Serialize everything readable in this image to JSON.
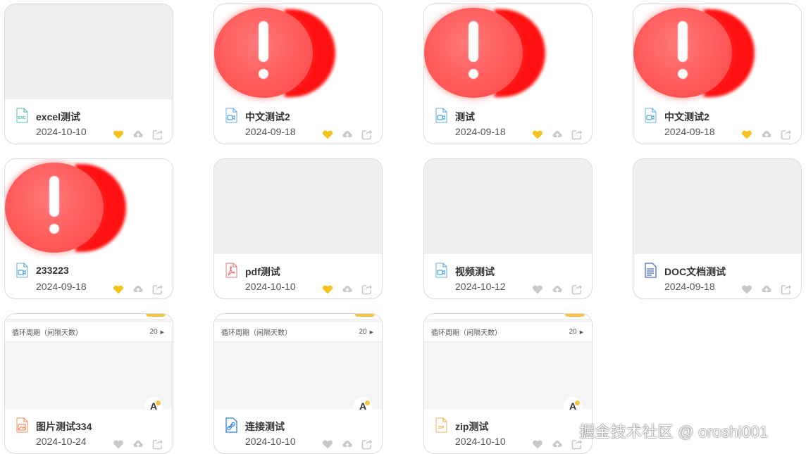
{
  "colors": {
    "favorite_active": "#f7c21b",
    "action_inactive": "#c8c8c8",
    "error_red": "#ff1111",
    "card_border": "#d9d9d9",
    "thumb_placeholder": "#efefef"
  },
  "cards": [
    {
      "name": "excel测试",
      "date": "2024-10-10",
      "file_icon": "excel-file-icon",
      "thumbnail": "placeholder",
      "favorited": true
    },
    {
      "name": "中文测试2",
      "date": "2024-09-18",
      "file_icon": "video-file-icon",
      "thumbnail": "error",
      "favorited": true
    },
    {
      "name": "测试",
      "date": "2024-09-18",
      "file_icon": "video-file-icon",
      "thumbnail": "error",
      "favorited": true
    },
    {
      "name": "中文测试2",
      "date": "2024-09-18",
      "file_icon": "video-file-icon",
      "thumbnail": "error",
      "favorited": true
    },
    {
      "name": "233223",
      "date": "2024-09-18",
      "file_icon": "video-file-icon",
      "thumbnail": "error",
      "favorited": true
    },
    {
      "name": "pdf测试",
      "date": "2024-10-10",
      "file_icon": "pdf-file-icon",
      "thumbnail": "placeholder",
      "favorited": true
    },
    {
      "name": "视频测试",
      "date": "2024-10-12",
      "file_icon": "video-file-icon",
      "thumbnail": "placeholder",
      "favorited": false
    },
    {
      "name": "DOC文档测试",
      "date": "2024-09-18",
      "file_icon": "doc-file-icon",
      "thumbnail": "placeholder",
      "favorited": false
    },
    {
      "name": "图片测试334",
      "date": "2024-10-24",
      "file_icon": "image-file-icon",
      "thumbnail": "crop",
      "favorited": false
    },
    {
      "name": "连接测试",
      "date": "2024-10-10",
      "file_icon": "link-file-icon",
      "thumbnail": "crop",
      "favorited": false
    },
    {
      "name": "zip测试",
      "date": "2024-10-10",
      "file_icon": "zip-file-icon",
      "thumbnail": "crop",
      "favorited": false
    }
  ],
  "crop_preview": {
    "label": "循环周期（间隔天数）",
    "value": "20"
  },
  "actions": [
    "heart-icon",
    "cloud-upload-icon",
    "share-icon"
  ],
  "watermark": "掘金技术社区 @ oroshi001"
}
